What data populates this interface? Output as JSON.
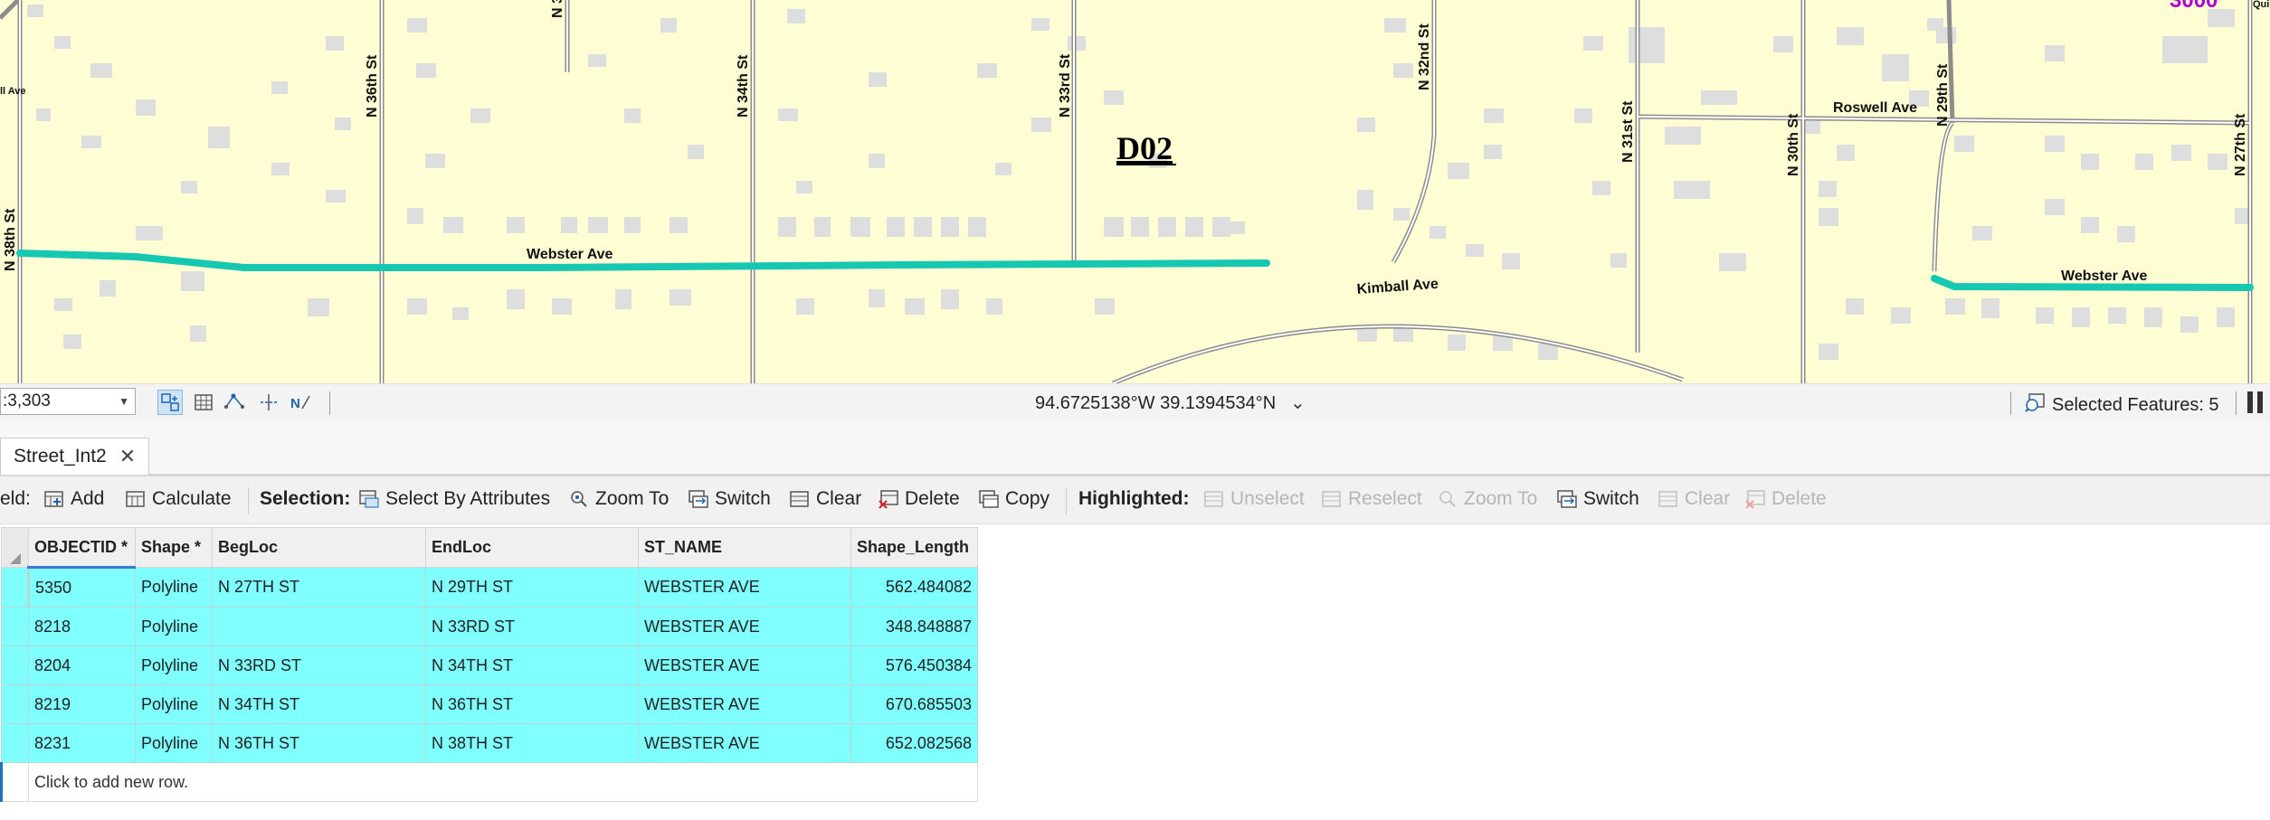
{
  "map": {
    "district_label": "D02",
    "corner_number": "3000",
    "streets": {
      "n38": "N 38th St",
      "n36": "N 36th St",
      "n34": "N 34th St",
      "n33rd": "N 33rd St",
      "n32": "N 32nd St",
      "n31": "N 31st St",
      "n30": "N 30th St",
      "n29": "N 29th St",
      "n27": "N 27th St",
      "n3_partial": "N 3",
      "webster1": "Webster Ave",
      "webster2": "Webster Ave",
      "kimball": "Kimball Ave",
      "roswell": "Roswell Ave",
      "left_ave": "ll Ave",
      "right_partial": "Qui"
    }
  },
  "statusbar": {
    "scale_value": ":3,303",
    "coordinates": "94.6725138°W 39.1394534°N",
    "selected_features": "Selected Features: 5"
  },
  "tab": {
    "label": "Street_Int2"
  },
  "toolbar": {
    "field_label": "eld:",
    "add": "Add",
    "calculate": "Calculate",
    "selection_label": "Selection:",
    "select_by_attributes": "Select By Attributes",
    "zoom_to": "Zoom To",
    "switch": "Switch",
    "clear": "Clear",
    "delete": "Delete",
    "copy": "Copy",
    "highlighted_label": "Highlighted:",
    "unselect": "Unselect",
    "reselect": "Reselect",
    "h_zoom_to": "Zoom To",
    "h_switch": "Switch",
    "h_clear": "Clear",
    "h_delete": "Delete"
  },
  "table": {
    "columns": [
      "OBJECTID *",
      "Shape *",
      "BegLoc",
      "EndLoc",
      "ST_NAME",
      "Shape_Length"
    ],
    "rows": [
      [
        "5350",
        "Polyline",
        "N 27TH ST",
        "N 29TH ST",
        "WEBSTER AVE",
        "562.484082"
      ],
      [
        "8218",
        "Polyline",
        "",
        "N 33RD ST",
        "WEBSTER AVE",
        "348.848887"
      ],
      [
        "8204",
        "Polyline",
        "N 33RD ST",
        "N 34TH ST",
        "WEBSTER AVE",
        "576.450384"
      ],
      [
        "8219",
        "Polyline",
        "N 34TH ST",
        "N 36TH ST",
        "WEBSTER AVE",
        "670.685503"
      ],
      [
        "8231",
        "Polyline",
        "N 36TH ST",
        "N 38TH ST",
        "WEBSTER AVE",
        "652.082568"
      ]
    ],
    "new_row_text": "Click to add new row."
  }
}
